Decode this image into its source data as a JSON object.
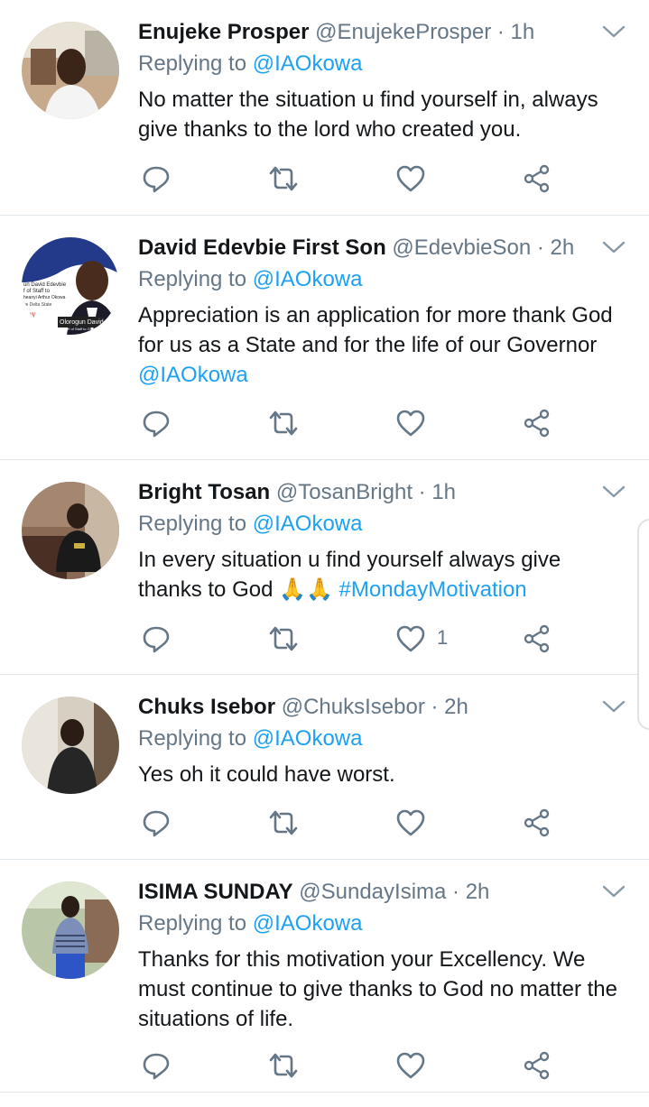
{
  "reply_prefix": "Replying to ",
  "reply_target": "@IAOkowa",
  "tweets": [
    {
      "name": "Enujeke Prosper",
      "handle": "@EnujekeProsper · 1h",
      "text": "No matter the situation u find yourself in, always give thanks to the lord who created you.",
      "likes": ""
    },
    {
      "name": "David Edevbie First Son",
      "handle": "@EdevbieSon · 2h",
      "text_before": "Appreciation is an application for more thank God for us as a State and for the life of our Governor ",
      "text_link": "@IAOkowa",
      "avatar_lines": [
        "un David Edevbie",
        "f of Staff to",
        "heanyi Arthur Okowa",
        "ve Delta State",
        "ppy",
        "lida",
        "Olorogun David E",
        "Chief of Staff to Governor"
      ],
      "likes": ""
    },
    {
      "name": "Bright Tosan",
      "handle": "@TosanBright · 1h",
      "text_before": "In every situation u find yourself always give thanks to God ",
      "emoji": "🙏🙏",
      "text_link": "#MondayMotivation",
      "likes": "1"
    },
    {
      "name": "Chuks Isebor",
      "handle": "@ChuksIsebor · 2h",
      "text": "Yes oh it could have worst.",
      "likes": ""
    },
    {
      "name": "ISIMA SUNDAY",
      "handle": "@SundayIsima · 2h",
      "text": "Thanks for this motivation your Excellency. We must continue to give thanks to God no matter the situations of life.",
      "likes": ""
    }
  ],
  "icons": {
    "reply": "reply-icon",
    "retweet": "retweet-icon",
    "like": "heart-icon",
    "share": "share-icon",
    "menu": "chevron-down-icon"
  },
  "colors": {
    "link": "#1da1f2",
    "muted": "#657786",
    "text": "#14171a",
    "divider": "#e1e8ed"
  }
}
